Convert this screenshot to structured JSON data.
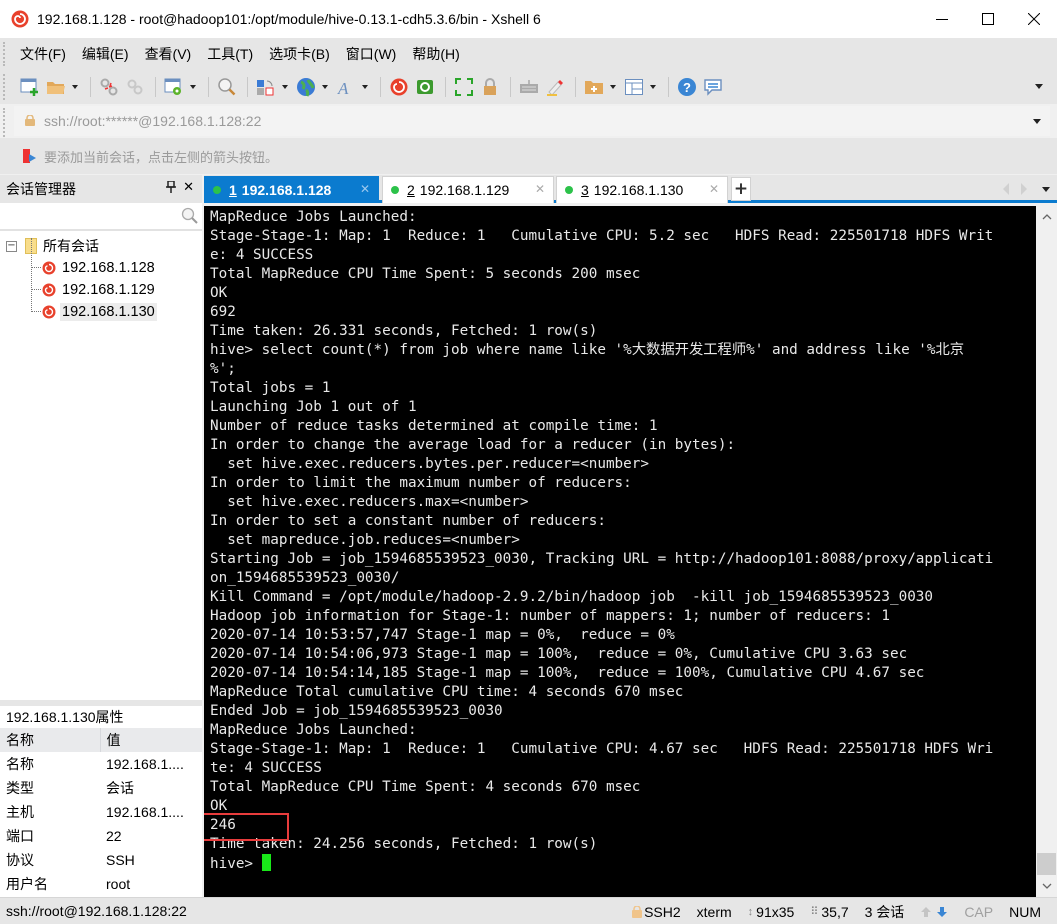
{
  "window": {
    "title": "192.168.1.128 - root@hadoop101:/opt/module/hive-0.13.1-cdh5.3.6/bin - Xshell 6"
  },
  "menu": {
    "items": [
      "文件(F)",
      "编辑(E)",
      "查看(V)",
      "工具(T)",
      "选项卡(B)",
      "窗口(W)",
      "帮助(H)"
    ]
  },
  "toolbar": {
    "icons": [
      "new-session-icon",
      "open-folder-icon",
      "disconnect-icon",
      "reconnect-icon",
      "properties-icon",
      "find-icon",
      "transfer-icon",
      "globe-icon",
      "font-icon",
      "xshell-icon",
      "xftp-icon",
      "fullscreen-icon",
      "lock-icon",
      "keyboard-icon",
      "highlight-icon",
      "add-folder-icon",
      "layout-icon",
      "help-icon",
      "chat-icon"
    ]
  },
  "address": {
    "value": "ssh://root:******@192.168.1.128:22"
  },
  "hint": {
    "text": "要添加当前会话，点击左侧的箭头按钮。"
  },
  "session_manager": {
    "title": "会话管理器",
    "search_placeholder": "",
    "root_label": "所有会话",
    "sessions": [
      {
        "label": "192.168.1.128",
        "selected": false
      },
      {
        "label": "192.168.1.129",
        "selected": false
      },
      {
        "label": "192.168.1.130",
        "selected": true
      }
    ]
  },
  "properties": {
    "title": "192.168.1.130属性",
    "headers": [
      "名称",
      "值"
    ],
    "rows": [
      [
        "名称",
        "192.168.1...."
      ],
      [
        "类型",
        "会话"
      ],
      [
        "主机",
        "192.168.1...."
      ],
      [
        "端口",
        "22"
      ],
      [
        "协议",
        "SSH"
      ],
      [
        "用户名",
        "root"
      ]
    ]
  },
  "tabs": [
    {
      "num": "1",
      "label": "192.168.1.128",
      "active": true
    },
    {
      "num": "2",
      "label": "192.168.1.129",
      "active": false
    },
    {
      "num": "3",
      "label": "192.168.1.130",
      "active": false
    }
  ],
  "terminal": {
    "prompt": "hive> ",
    "lines": [
      "MapReduce Jobs Launched: ",
      "Stage-Stage-1: Map: 1  Reduce: 1   Cumulative CPU: 5.2 sec   HDFS Read: 225501718 HDFS Writ",
      "e: 4 SUCCESS",
      "Total MapReduce CPU Time Spent: 5 seconds 200 msec",
      "OK",
      "692",
      "Time taken: 26.331 seconds, Fetched: 1 row(s)",
      "hive> select count(*) from job where name like '%大数据开发工程师%' and address like '%北京",
      "%';",
      "Total jobs = 1",
      "Launching Job 1 out of 1",
      "Number of reduce tasks determined at compile time: 1",
      "In order to change the average load for a reducer (in bytes):",
      "  set hive.exec.reducers.bytes.per.reducer=<number>",
      "In order to limit the maximum number of reducers:",
      "  set hive.exec.reducers.max=<number>",
      "In order to set a constant number of reducers:",
      "  set mapreduce.job.reduces=<number>",
      "Starting Job = job_1594685539523_0030, Tracking URL = http://hadoop101:8088/proxy/applicati",
      "on_1594685539523_0030/",
      "Kill Command = /opt/module/hadoop-2.9.2/bin/hadoop job  -kill job_1594685539523_0030",
      "Hadoop job information for Stage-1: number of mappers: 1; number of reducers: 1",
      "2020-07-14 10:53:57,747 Stage-1 map = 0%,  reduce = 0%",
      "2020-07-14 10:54:06,973 Stage-1 map = 100%,  reduce = 0%, Cumulative CPU 3.63 sec",
      "2020-07-14 10:54:14,185 Stage-1 map = 100%,  reduce = 100%, Cumulative CPU 4.67 sec",
      "MapReduce Total cumulative CPU time: 4 seconds 670 msec",
      "Ended Job = job_1594685539523_0030",
      "MapReduce Jobs Launched: ",
      "Stage-Stage-1: Map: 1  Reduce: 1   Cumulative CPU: 4.67 sec   HDFS Read: 225501718 HDFS Wri",
      "te: 4 SUCCESS",
      "Total MapReduce CPU Time Spent: 4 seconds 670 msec",
      "OK",
      "246",
      "Time taken: 24.256 seconds, Fetched: 1 row(s)"
    ],
    "highlighted_result": "246"
  },
  "statusbar": {
    "connection": "ssh://root@192.168.1.128:22",
    "protocol": "SSH2",
    "term": "xterm",
    "size": "91x35",
    "cursor": "35,7",
    "sessions": "3 会话",
    "cap": "CAP",
    "num": "NUM"
  },
  "colors": {
    "accent": "#0b7bcf",
    "cursor": "#19e819",
    "highlight_box": "#e83c3c",
    "session_dot": "#2cc24a"
  }
}
